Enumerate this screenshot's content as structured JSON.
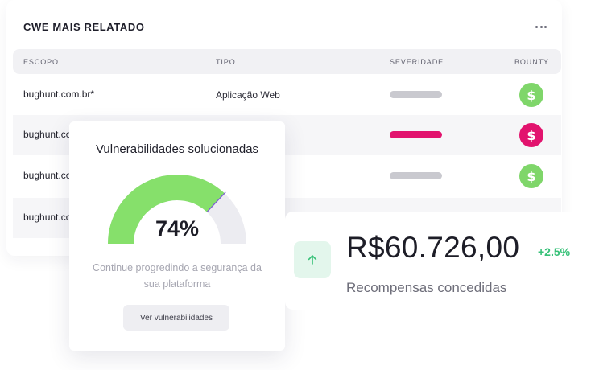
{
  "card": {
    "title": "CWE MAIS RELATADO",
    "more_icon": "more-horizontal-icon"
  },
  "table": {
    "columns": [
      "ESCOPO",
      "TIPO",
      "SEVERIDADE",
      "BOUNTY"
    ],
    "rows": [
      {
        "scope": "bughunt.com.br*",
        "type": "Aplicação Web",
        "severity_color": "#c9c9cf",
        "bounty_color": "#7fd66a"
      },
      {
        "scope": "bughunt.co",
        "type": "",
        "severity_color": "#e2136e",
        "bounty_color": "#e2136e"
      },
      {
        "scope": "bughunt.co",
        "type": "",
        "severity_color": "#c9c9cf",
        "bounty_color": "#7fd66a"
      },
      {
        "scope": "bughunt.co",
        "type": "",
        "severity_color": "",
        "bounty_color": ""
      }
    ],
    "bounty_icon": "dollar-icon",
    "bounty_symbol": "$"
  },
  "gauge": {
    "title": "Vulnerabilidades solucionadas",
    "value_label": "74%",
    "percent": 74,
    "fill_color": "#86e06b",
    "track_color": "#ececf1",
    "marker_color": "#7b58d6",
    "description": "Continue progredindo a segurança da sua plataforma",
    "button_label": "Ver vulnerabilidades"
  },
  "rewards": {
    "amount": "R$60.726,00",
    "delta": "+2.5%",
    "label": "Recompensas concedidas",
    "arrow_icon": "arrow-up-icon",
    "accent_color": "#37c178"
  }
}
